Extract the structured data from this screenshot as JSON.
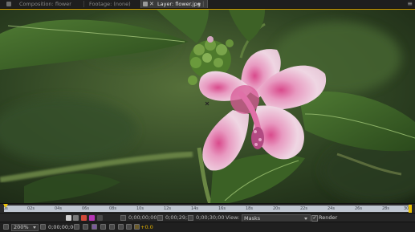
{
  "tabs": [
    {
      "label": "Composition: flower",
      "active": false
    },
    {
      "label": "Footage: (none)",
      "active": false
    },
    {
      "label": "Layer: flower.jpg",
      "active": true
    }
  ],
  "ruler": {
    "ticks": [
      "0s",
      "02s",
      "04s",
      "06s",
      "08s",
      "10s",
      "12s",
      "14s",
      "16s",
      "18s",
      "20s",
      "22s",
      "24s",
      "26s",
      "28s",
      "30s"
    ]
  },
  "layer_controls": {
    "in_time": "0;00;00;00",
    "out_time": "0;00;29;29",
    "duration": "0;00;30;00",
    "view_label": "View:",
    "view_value": "Masks",
    "render_label": "Render",
    "render_checked": true
  },
  "viewer_footer": {
    "zoom": "200%",
    "current_time": "0;00;00;00",
    "exposure": "+0.0"
  },
  "colors": {
    "accent": "#e9c000",
    "ruler": "#bfc6d1",
    "panel": "#232323"
  }
}
